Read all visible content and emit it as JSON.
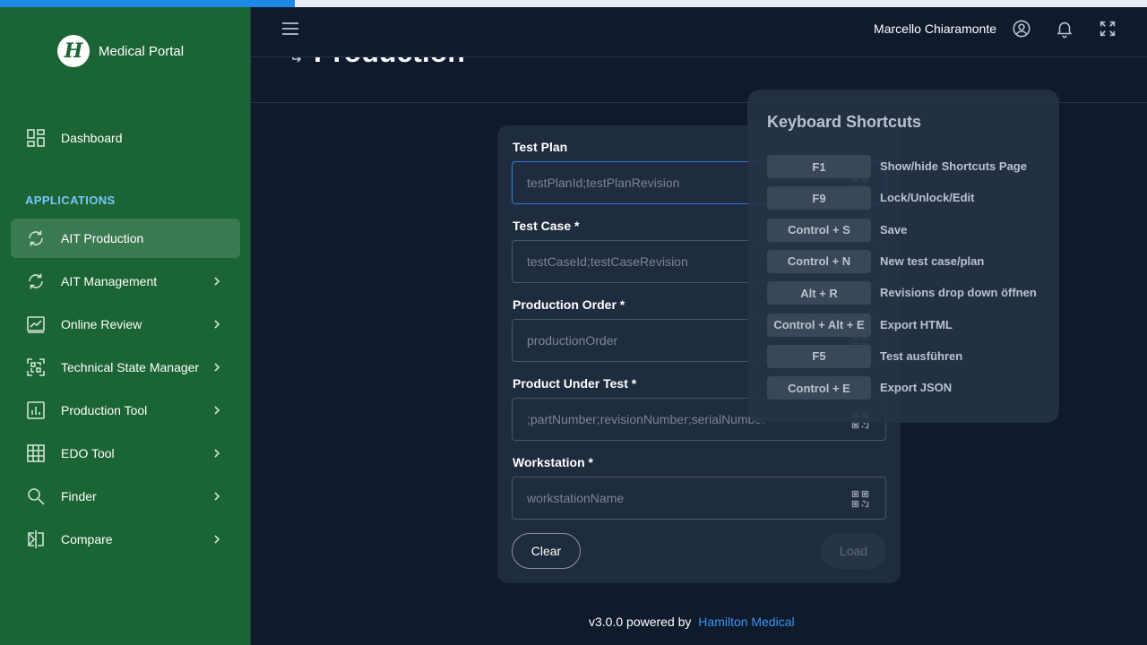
{
  "progress": {
    "percent": 25.7,
    "color": "#1e88e5"
  },
  "brand": {
    "logo_letter": "H",
    "name": "Medical Portal"
  },
  "sidebar": {
    "dashboard_label": "Dashboard",
    "section_label": "APPLICATIONS",
    "items": [
      {
        "label": "AIT Production",
        "icon": "refresh-icon",
        "active": true,
        "has_chevron": false
      },
      {
        "label": "AIT Management",
        "icon": "refresh-icon",
        "active": false,
        "has_chevron": true
      },
      {
        "label": "Online Review",
        "icon": "chart-review-icon",
        "active": false,
        "has_chevron": true
      },
      {
        "label": "Technical State Manager",
        "icon": "qr-scan-icon",
        "active": false,
        "has_chevron": true
      },
      {
        "label": "Production Tool",
        "icon": "bar-chart-icon",
        "active": false,
        "has_chevron": true
      },
      {
        "label": "EDO Tool",
        "icon": "grid-icon",
        "active": false,
        "has_chevron": true
      },
      {
        "label": "Finder",
        "icon": "search-icon",
        "active": false,
        "has_chevron": true
      },
      {
        "label": "Compare",
        "icon": "compare-icon",
        "active": false,
        "has_chevron": true
      }
    ]
  },
  "header": {
    "user_name": "Marcello Chiaramonte"
  },
  "page": {
    "title": "Production"
  },
  "form": {
    "fields": [
      {
        "label": "Test Plan",
        "placeholder": "testPlanId;testPlanRevision"
      },
      {
        "label": "Test Case *",
        "placeholder": "testCaseId;testCaseRevision"
      },
      {
        "label": "Production Order *",
        "placeholder": "productionOrder"
      },
      {
        "label": "Product Under Test *",
        "placeholder": ";partNumber;revisionNumber;serialNumber"
      },
      {
        "label": "Workstation *",
        "placeholder": "workstationName"
      }
    ],
    "clear_label": "Clear",
    "load_label": "Load"
  },
  "shortcuts": {
    "title": "Keyboard Shortcuts",
    "items": [
      {
        "key": "F1",
        "desc": "Show/hide Shortcuts Page"
      },
      {
        "key": "F9",
        "desc": "Lock/Unlock/Edit"
      },
      {
        "key": "Control + S",
        "desc": "Save"
      },
      {
        "key": "Control + N",
        "desc": "New test case/plan"
      },
      {
        "key": "Alt + R",
        "desc": "Revisions drop down öffnen"
      },
      {
        "key": "Control + Alt + E",
        "desc": "Export HTML"
      },
      {
        "key": "F5",
        "desc": "Test ausführen"
      },
      {
        "key": "Control + E",
        "desc": "Export JSON"
      }
    ]
  },
  "footer": {
    "text": "v3.0.0 powered by",
    "link": "Hamilton Medical"
  }
}
